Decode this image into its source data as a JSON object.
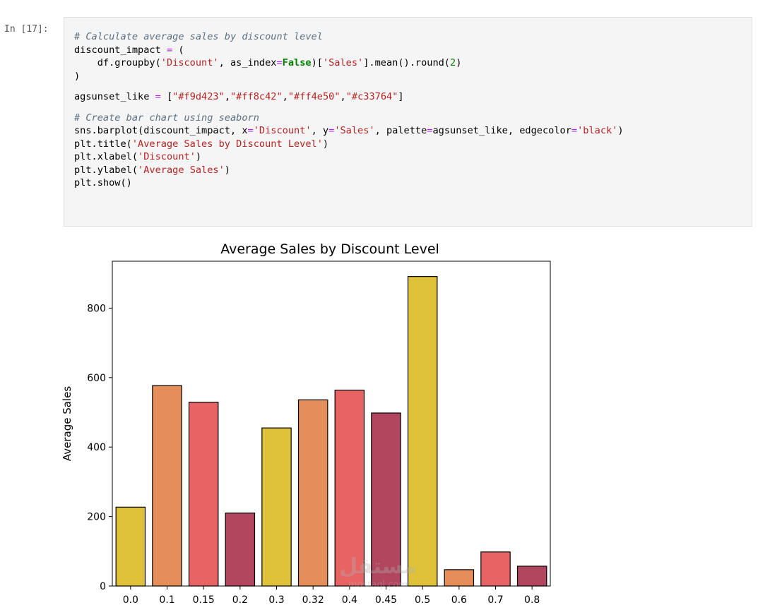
{
  "cell": {
    "prompt": "In [17]:",
    "code": {
      "comment1": "# Calculate average sales by discount level",
      "l2_a": "discount_impact ",
      "l2_eq": "=",
      "l2_b": " (",
      "l3_a": "    df.groupby(",
      "l3_s1": "'Discount'",
      "l3_b": ", as_index",
      "l3_eq": "=",
      "l3_kw": "False",
      "l3_c": ")[",
      "l3_s2": "'Sales'",
      "l3_d": "].mean().round(",
      "l3_n": "2",
      "l3_e": ")",
      "l4": ")",
      "l6_a": "agsunset_like ",
      "l6_eq": "=",
      "l6_b": " [",
      "l6_s1": "\"#f9d423\"",
      "l6_s2": "\"#ff8c42\"",
      "l6_s3": "\"#ff4e50\"",
      "l6_s4": "\"#c33764\"",
      "l6_comma": ",",
      "l6_c": "]",
      "comment2": "# Create bar chart using seaborn",
      "l9_a": "sns.barplot(discount_impact, x",
      "l9_eq1": "=",
      "l9_s1": "'Discount'",
      "l9_b": ", y",
      "l9_eq2": "=",
      "l9_s2": "'Sales'",
      "l9_c": ", palette",
      "l9_eq3": "=",
      "l9_d": "agsunset_like, edgecolor",
      "l9_eq4": "=",
      "l9_s3": "'black'",
      "l9_e": ")",
      "l10_a": "plt.title(",
      "l10_s": "'Average Sales by Discount Level'",
      "l10_b": ")",
      "l11_a": "plt.xlabel(",
      "l11_s": "'Discount'",
      "l11_b": ")",
      "l12_a": "plt.ylabel(",
      "l12_s": "'Average Sales'",
      "l12_b": ")",
      "l13": "plt.show()"
    }
  },
  "chart_data": {
    "type": "bar",
    "title": "Average Sales by Discount Level",
    "xlabel": "",
    "ylabel": "Average Sales",
    "categories": [
      "0.0",
      "0.1",
      "0.15",
      "0.2",
      "0.3",
      "0.32",
      "0.4",
      "0.45",
      "0.5",
      "0.6",
      "0.7",
      "0.8"
    ],
    "values": [
      227,
      577,
      529,
      210,
      455,
      536,
      564,
      498,
      891,
      47,
      98,
      57
    ],
    "yticks": [
      0,
      200,
      400,
      600,
      800
    ],
    "ylim": [
      0,
      935
    ],
    "palette": [
      "#dfc23a",
      "#e58e5a",
      "#e86464",
      "#b2465e"
    ],
    "edgecolor": "#000000",
    "grid": false
  },
  "watermark": {
    "text": "mostaql.com"
  }
}
